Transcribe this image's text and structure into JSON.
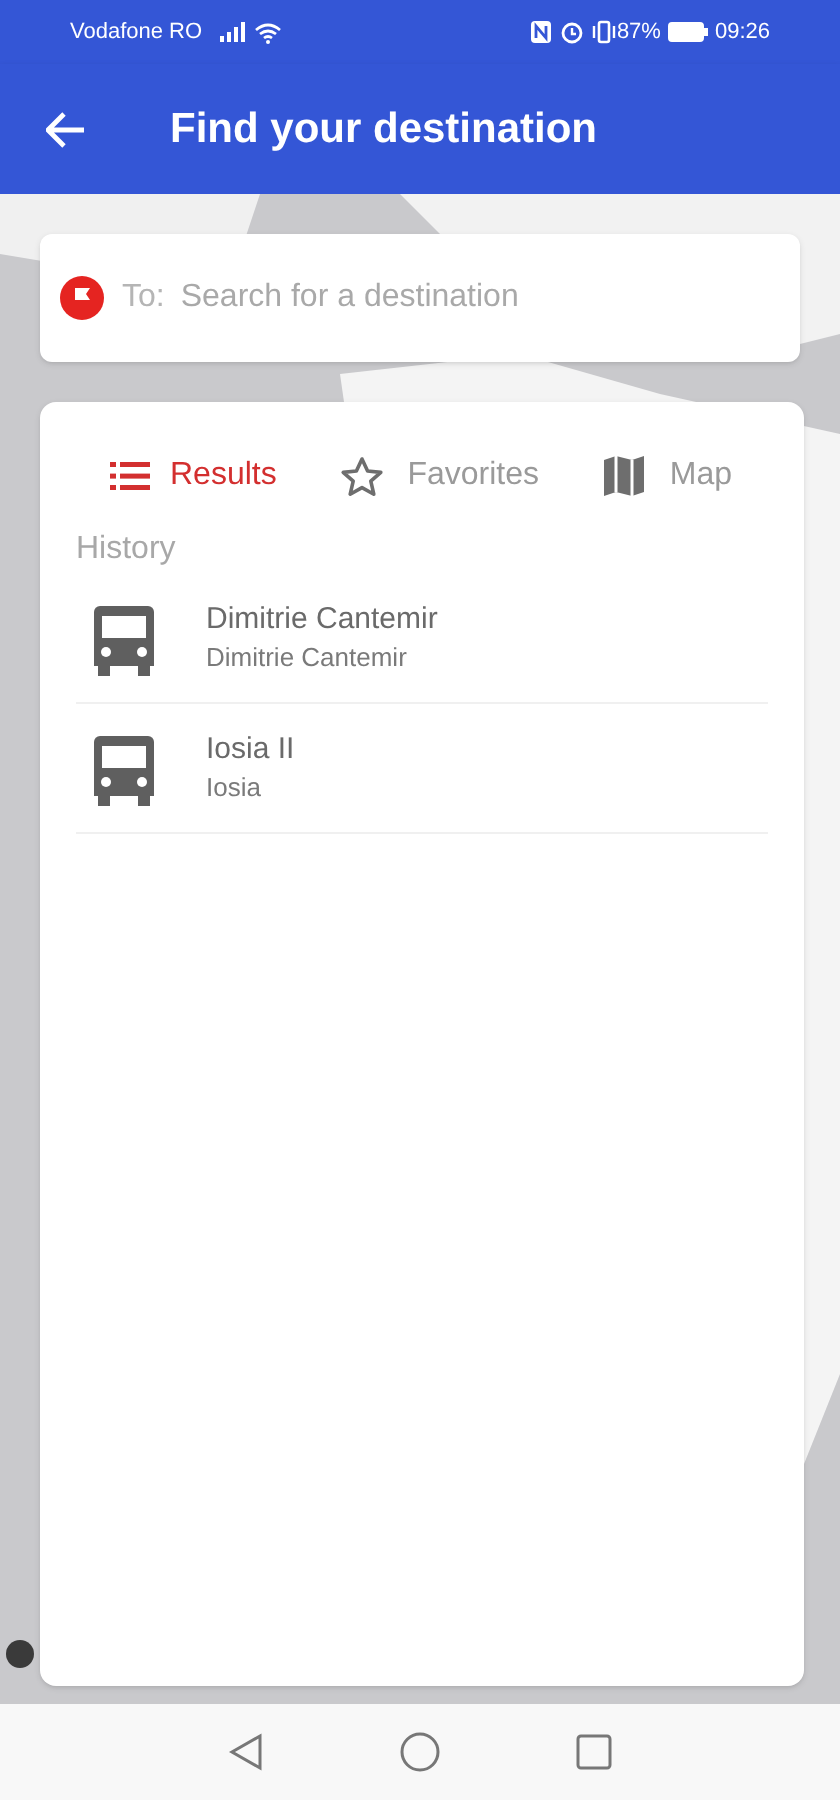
{
  "status_bar": {
    "carrier": "Vodafone RO",
    "battery": "87%",
    "time": "09:26"
  },
  "app_bar": {
    "title": "Find your destination"
  },
  "search": {
    "prefix": "To:",
    "placeholder": "Search for a destination"
  },
  "tabs": [
    {
      "label": "Results",
      "selected": true
    },
    {
      "label": "Favorites",
      "selected": false
    },
    {
      "label": "Map",
      "selected": false
    }
  ],
  "history": {
    "heading": "History",
    "items": [
      {
        "title": "Dimitrie Cantemir",
        "subtitle": "Dimitrie Cantemir"
      },
      {
        "title": "Iosia II",
        "subtitle": "Iosia"
      }
    ]
  }
}
